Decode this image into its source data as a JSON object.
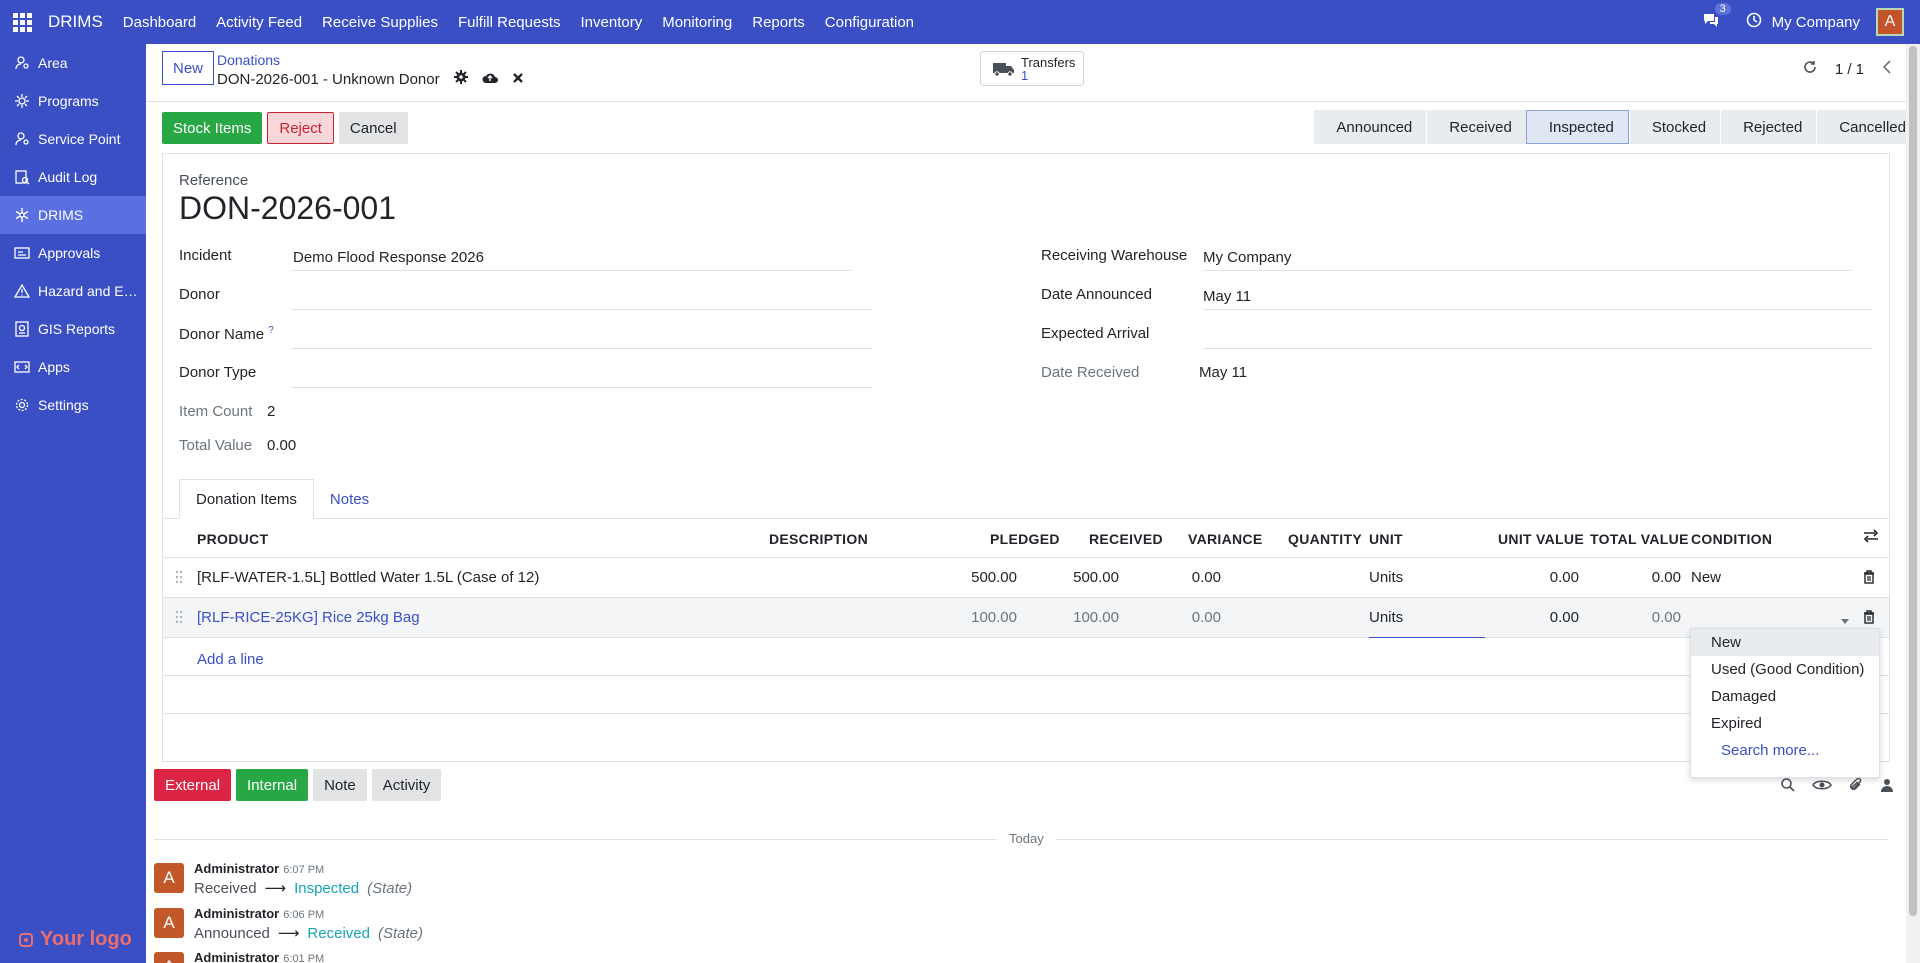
{
  "topbar": {
    "brand": "DRIMS",
    "menu": [
      "Dashboard",
      "Activity Feed",
      "Receive Supplies",
      "Fulfill Requests",
      "Inventory",
      "Monitoring",
      "Reports",
      "Configuration"
    ],
    "message_count": "3",
    "company": "My Company",
    "avatar_letter": "A"
  },
  "sidebar": {
    "items": [
      {
        "label": "Area",
        "icon": "user-pin-icon"
      },
      {
        "label": "Programs",
        "icon": "gear-star-icon"
      },
      {
        "label": "Service Point",
        "icon": "user-pin-icon"
      },
      {
        "label": "Audit Log",
        "icon": "audit-icon"
      },
      {
        "label": "DRIMS",
        "icon": "snowflake-icon"
      },
      {
        "label": "Approvals",
        "icon": "approvals-icon"
      },
      {
        "label": "Hazard and E…",
        "icon": "warning-icon"
      },
      {
        "label": "GIS Reports",
        "icon": "gis-icon"
      },
      {
        "label": "Apps",
        "icon": "apps-icon"
      },
      {
        "label": "Settings",
        "icon": "settings-icon"
      }
    ],
    "logo_text": "Your logo"
  },
  "control_panel": {
    "new_label": "New",
    "breadcrumb": "Donations",
    "record_title": "DON-2026-001 - Unknown Donor",
    "transfers_label": "Transfers",
    "transfers_count": "1",
    "pager": "1 / 1"
  },
  "status_bar": {
    "buttons": [
      "Stock Items",
      "Reject",
      "Cancel"
    ],
    "stages": [
      "Announced",
      "Received",
      "Inspected",
      "Stocked",
      "Rejected",
      "Cancelled"
    ],
    "current_stage": "Inspected"
  },
  "form": {
    "reference_label": "Reference",
    "reference": "DON-2026-001",
    "incident_label": "Incident",
    "incident": "Demo Flood Response 2026",
    "donor_label": "Donor",
    "donor": "",
    "donor_name_label": "Donor Name",
    "donor_name_help": "?",
    "donor_name": "",
    "donor_type_label": "Donor Type",
    "donor_type": "",
    "item_count_label": "Item Count",
    "item_count": "2",
    "total_value_label": "Total Value",
    "total_value": "0.00",
    "warehouse_label": "Receiving Warehouse",
    "warehouse": "My Company",
    "date_announced_label": "Date Announced",
    "date_announced": "May 11",
    "expected_arrival_label": "Expected Arrival",
    "expected_arrival": "",
    "date_received_label": "Date Received",
    "date_received": "May 11"
  },
  "tabs": [
    "Donation Items",
    "Notes"
  ],
  "table": {
    "headers": [
      "PRODUCT",
      "DESCRIPTION",
      "PLEDGED",
      "RECEIVED",
      "VARIANCE",
      "QUANTITY",
      "UNIT",
      "UNIT VALUE",
      "TOTAL VALUE",
      "CONDITION"
    ],
    "rows": [
      {
        "product": "[RLF-WATER-1.5L] Bottled Water 1.5L (Case of 12)",
        "pledged": "500.00",
        "received": "500.00",
        "variance": "0.00",
        "unit": "Units",
        "unit_value": "0.00",
        "total_value": "0.00",
        "condition": "New"
      },
      {
        "product": "[RLF-RICE-25KG] Rice 25kg Bag",
        "pledged": "100.00",
        "received": "100.00",
        "variance": "0.00",
        "unit": "Units",
        "unit_value": "0.00",
        "total_value": "0.00",
        "condition": ""
      }
    ],
    "add_line": "Add a line"
  },
  "condition_dropdown": {
    "options": [
      "New",
      "Used (Good Condition)",
      "Damaged",
      "Expired"
    ],
    "search_more": "Search more..."
  },
  "chatter": {
    "buttons": [
      "External",
      "Internal",
      "Note",
      "Activity"
    ],
    "today_label": "Today",
    "messages": [
      {
        "author": "Administrator",
        "time": "6:07 PM",
        "old": "Received",
        "new": "Inspected",
        "field": "(State)"
      },
      {
        "author": "Administrator",
        "time": "6:06 PM",
        "old": "Announced",
        "new": "Received",
        "field": "(State)"
      },
      {
        "author": "Administrator",
        "time": "6:01 PM"
      }
    ]
  },
  "colors": {
    "navbar": "#3a4fc4",
    "green": "#28a745",
    "red": "#dc2545",
    "avatar": "#c2572a"
  }
}
